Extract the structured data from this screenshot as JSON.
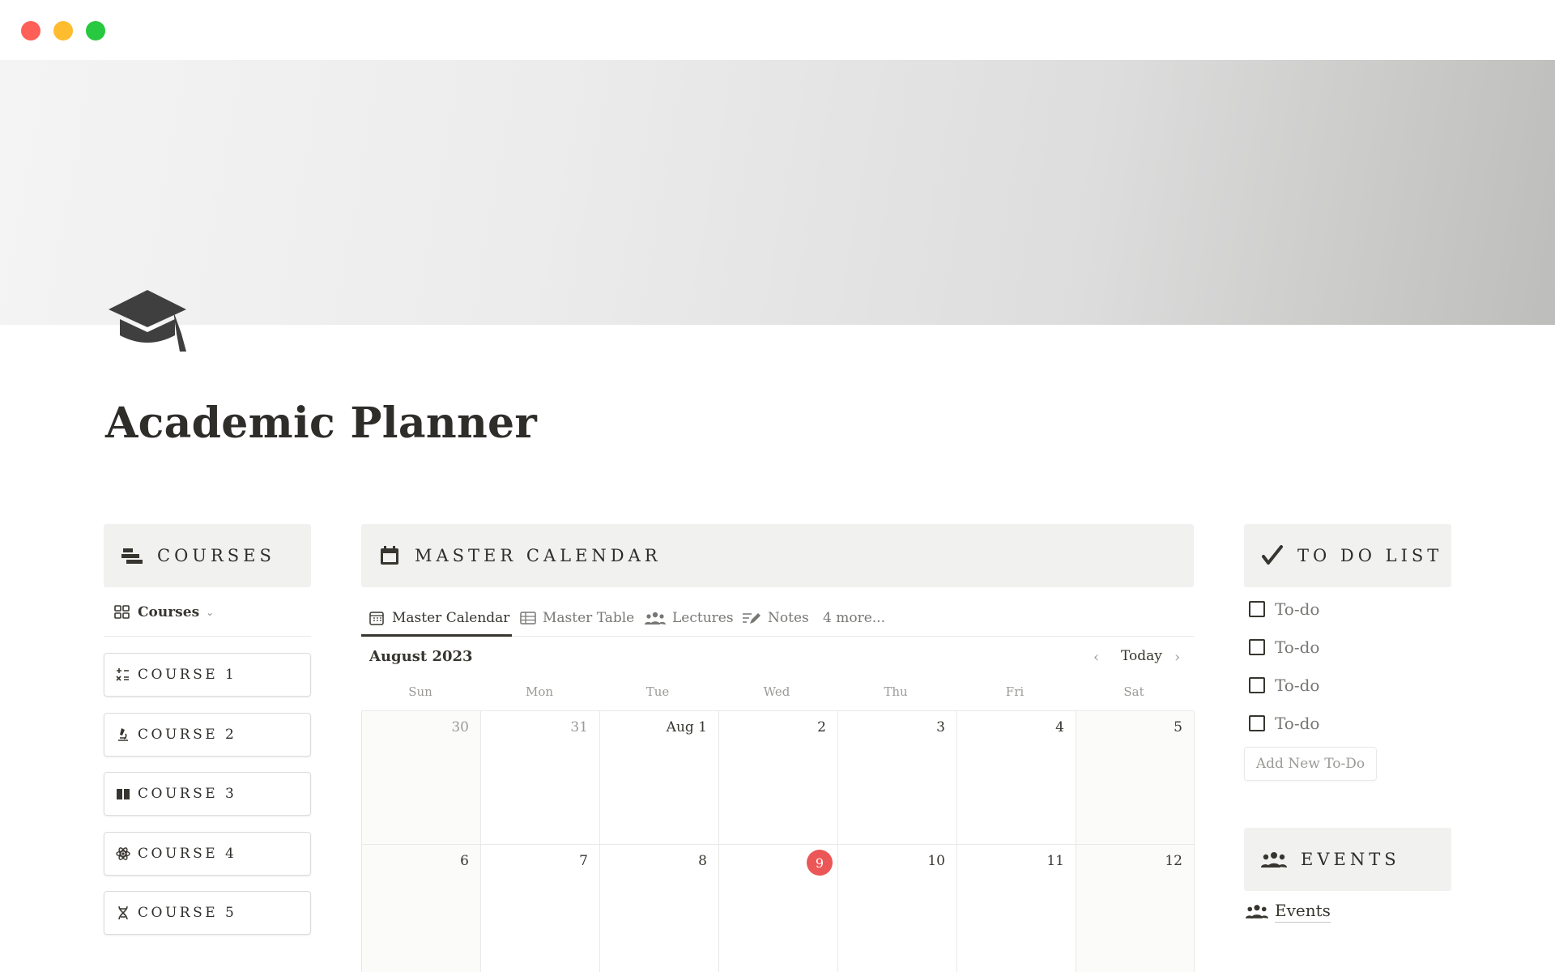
{
  "window": {
    "controls": [
      "close",
      "minimize",
      "maximize"
    ]
  },
  "page": {
    "icon": "graduation-cap-icon",
    "title": "Academic Planner"
  },
  "courses": {
    "header": "COURSES",
    "header_icon": "stacked-bars-icon",
    "view": {
      "label": "Courses",
      "icon": "gallery-grid-icon"
    },
    "items": [
      {
        "label": "COURSE 1",
        "icon": "math-operators-icon"
      },
      {
        "label": "COURSE 2",
        "icon": "microscope-icon"
      },
      {
        "label": "COURSE 3",
        "icon": "book-icon"
      },
      {
        "label": "COURSE 4",
        "icon": "atom-icon"
      },
      {
        "label": "COURSE 5",
        "icon": "dna-icon"
      }
    ]
  },
  "calendar": {
    "header": "MASTER CALENDAR",
    "header_icon": "calendar-icon",
    "tabs": [
      {
        "label": "Master Calendar",
        "icon": "calendar-icon",
        "active": true
      },
      {
        "label": "Master Table",
        "icon": "table-icon",
        "active": false
      },
      {
        "label": "Lectures",
        "icon": "people-icon",
        "active": false
      },
      {
        "label": "Notes",
        "icon": "pencil-lines-icon",
        "active": false
      },
      {
        "label": "4 more...",
        "icon": "",
        "active": false
      }
    ],
    "month": "August 2023",
    "today_label": "Today",
    "weekdays": [
      "Sun",
      "Mon",
      "Tue",
      "Wed",
      "Thu",
      "Fri",
      "Sat"
    ],
    "weeks": [
      [
        {
          "d": "30",
          "muted": true
        },
        {
          "d": "31",
          "muted": true
        },
        {
          "d": "Aug 1"
        },
        {
          "d": "2"
        },
        {
          "d": "3"
        },
        {
          "d": "4"
        },
        {
          "d": "5"
        }
      ],
      [
        {
          "d": "6"
        },
        {
          "d": "7"
        },
        {
          "d": "8"
        },
        {
          "d": "9",
          "today": true
        },
        {
          "d": "10"
        },
        {
          "d": "11"
        },
        {
          "d": "12"
        }
      ]
    ],
    "today_color": "#eb5757"
  },
  "todo": {
    "header": "TO DO LIST",
    "header_icon": "checkmark-icon",
    "items": [
      "To-do",
      "To-do",
      "To-do",
      "To-do"
    ],
    "add_label": "Add New To-Do"
  },
  "events": {
    "header": "EVENTS",
    "header_icon": "people-icon",
    "link_label": "Events"
  }
}
